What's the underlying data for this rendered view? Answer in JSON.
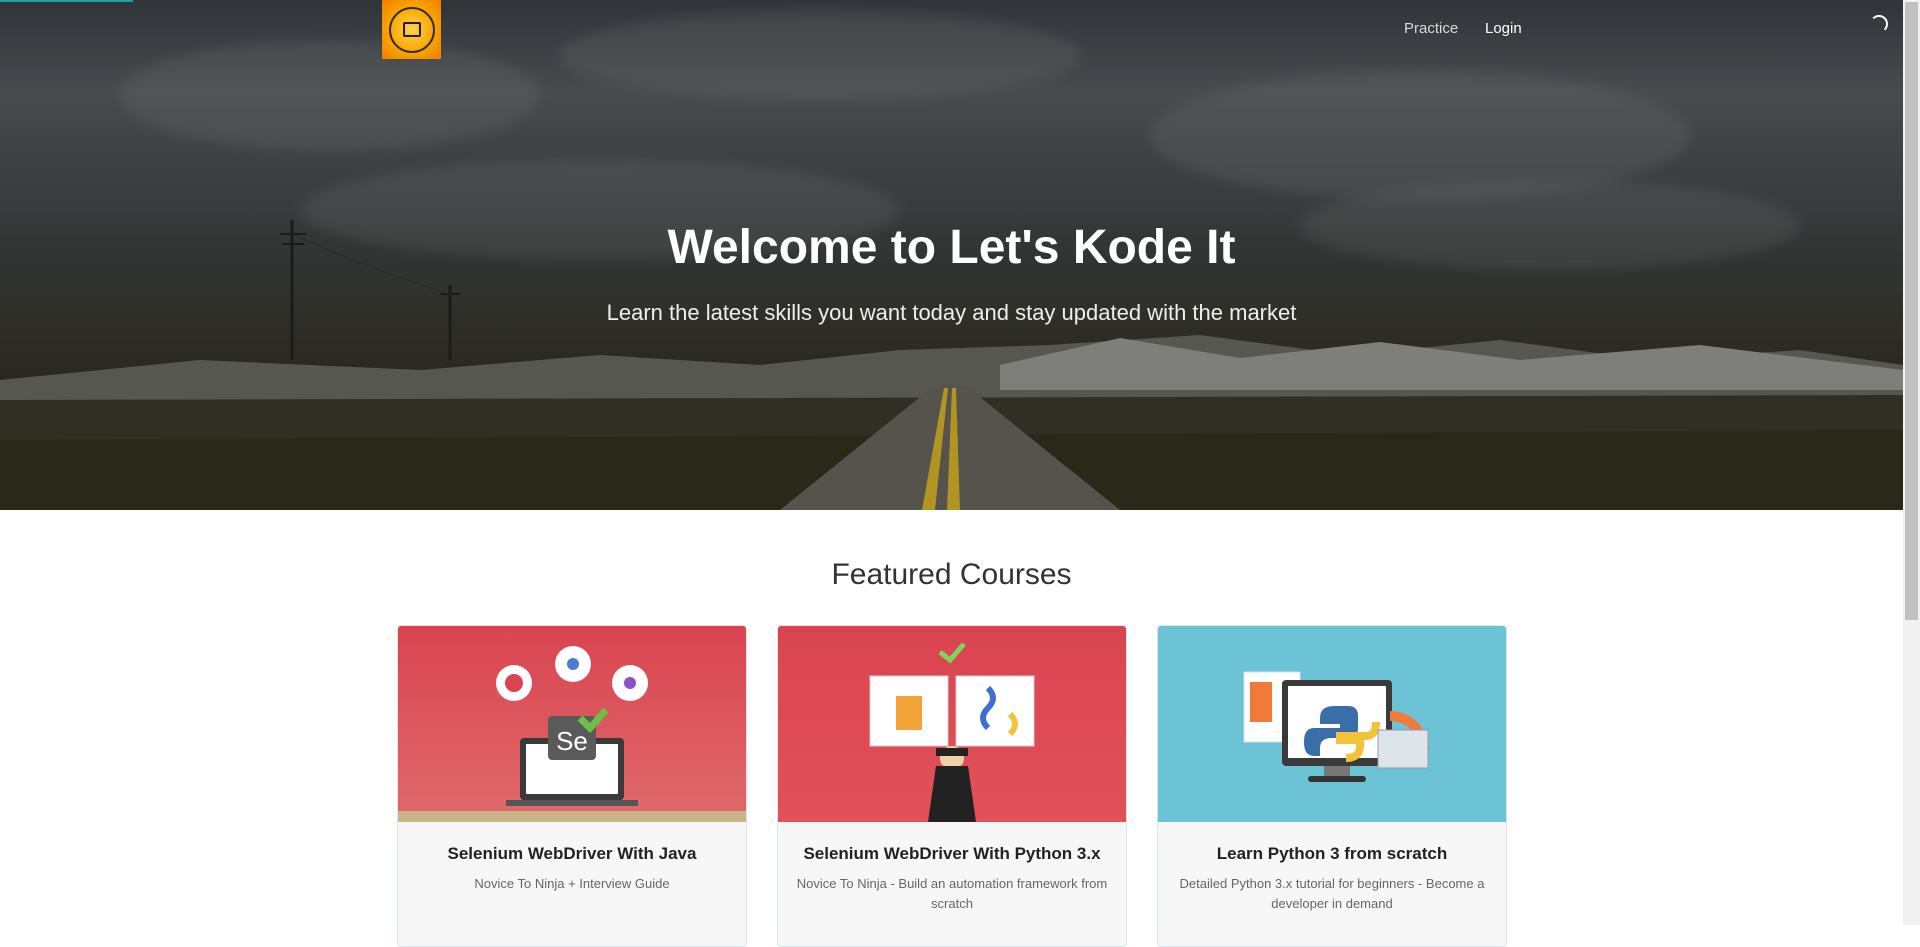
{
  "nav": {
    "logo_alt": "Let's Kode It",
    "links": [
      "Practice",
      "Login"
    ]
  },
  "hero": {
    "title": "Welcome to Let's Kode It",
    "subtitle": "Learn the latest skills you want today and stay updated with the market"
  },
  "featured": {
    "heading": "Featured Courses",
    "courses": [
      {
        "title": "Selenium WebDriver With Java",
        "description": "Novice To Ninja + Interview Guide",
        "image_icon": "selenium-java-icon",
        "bg_color": "#d9474d"
      },
      {
        "title": "Selenium WebDriver With Python 3.x",
        "description": "Novice To Ninja - Build an automation framework from scratch",
        "image_icon": "selenium-python-icon",
        "bg_color": "#d9474d"
      },
      {
        "title": "Learn Python 3 from scratch",
        "description": "Detailed Python 3.x tutorial for beginners - Become a developer in demand",
        "image_icon": "python-monitor-icon",
        "bg_color": "#6dc3d6"
      }
    ]
  },
  "colors": {
    "accent": "#1aa39a"
  }
}
